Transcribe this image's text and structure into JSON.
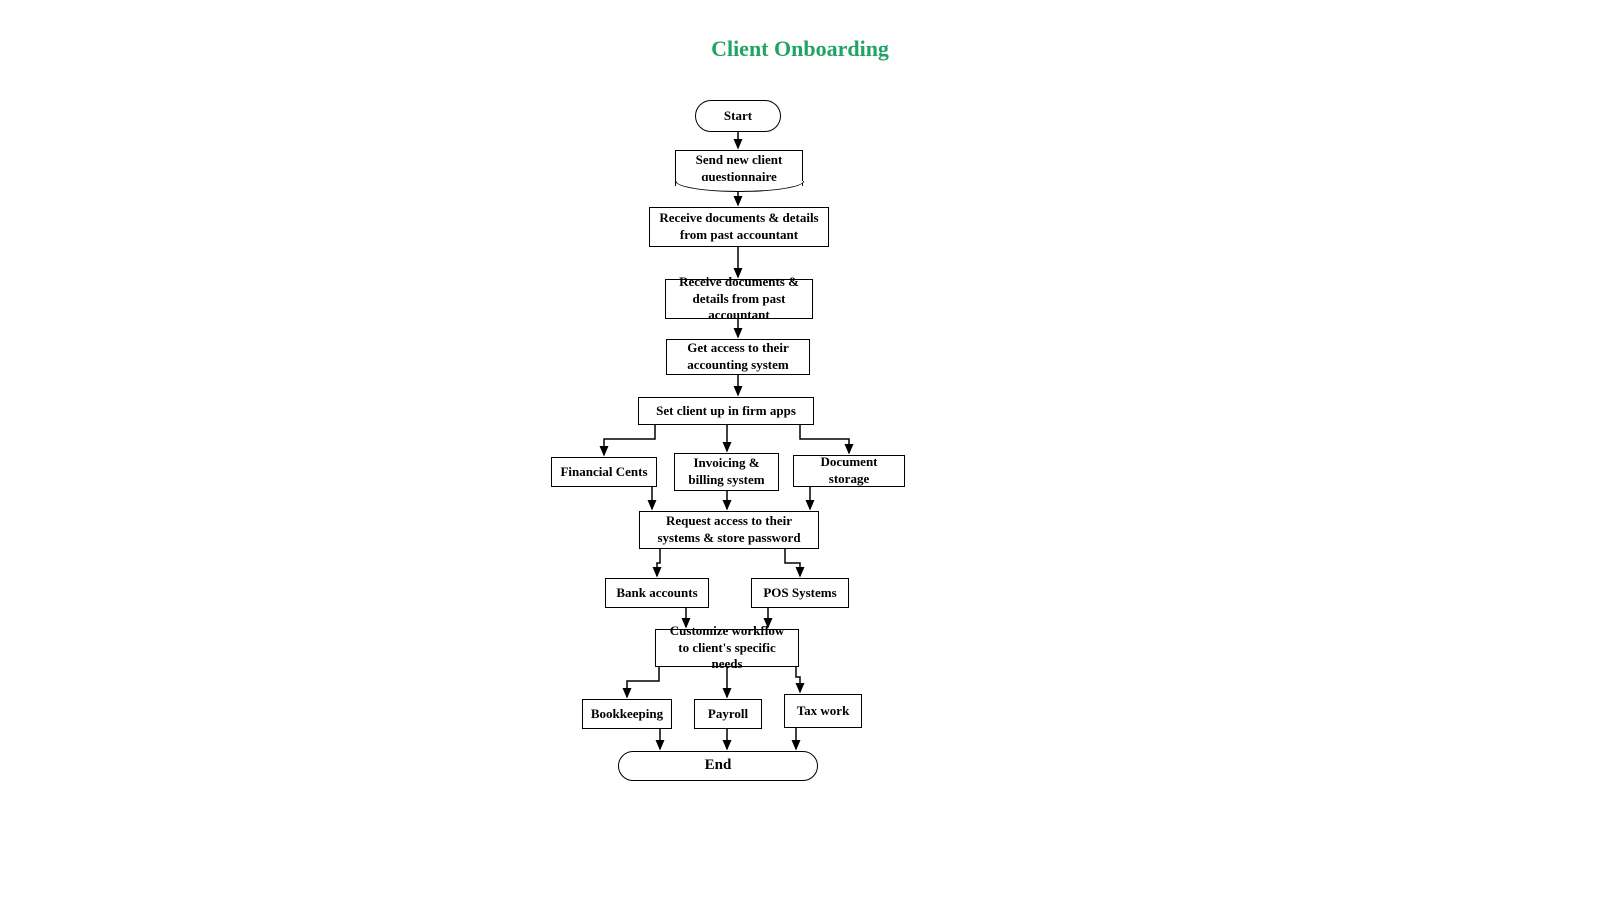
{
  "title": "Client Onboarding",
  "nodes": {
    "start": "Start",
    "send_q": "Send new client questionnaire",
    "recv1": "Receive documents & details from past accountant",
    "recv2": "Receive documents & details from past accountant",
    "get_access": "Get access to their accounting system",
    "setup_apps": "Set client up in firm apps",
    "fin_cents": "Financial Cents",
    "invoicing": "Invoicing & billing system",
    "doc_storage": "Document storage",
    "request_access": "Request access to their systems & store password",
    "bank": "Bank accounts",
    "pos": "POS Systems",
    "customize": "Customize workflow to client's specific needs",
    "bookkeeping": "Bookkeeping",
    "payroll": "Payroll",
    "tax": "Tax work",
    "end": "End"
  },
  "colors": {
    "title": "#1fa463"
  }
}
